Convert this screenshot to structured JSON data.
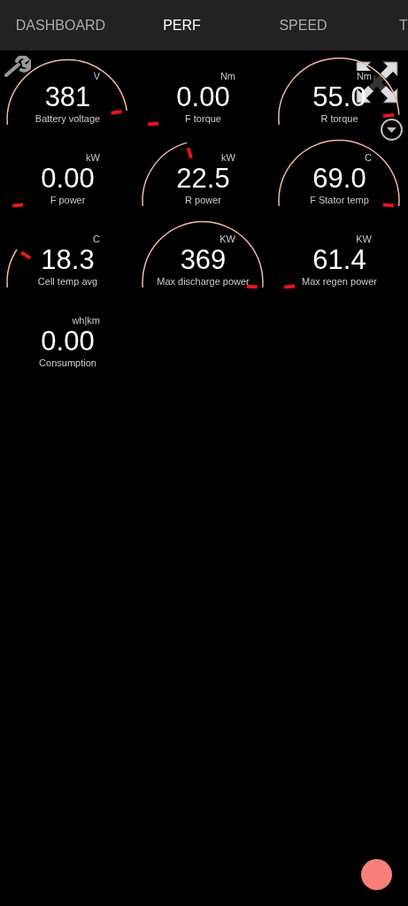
{
  "tabs": [
    {
      "label": "DASHBOARD",
      "selected": false
    },
    {
      "label": "PERF",
      "selected": true
    },
    {
      "label": "SPEED",
      "selected": false
    },
    {
      "label": "T",
      "selected": false
    }
  ],
  "gauges": [
    {
      "value": "381",
      "unit": "V",
      "label": "Battery voltage"
    },
    {
      "value": "0.00",
      "unit": "Nm",
      "label": "F torque"
    },
    {
      "value": "55.0",
      "unit": "Nm",
      "label": "R torque"
    },
    {
      "value": "0.00",
      "unit": "kW",
      "label": "F power"
    },
    {
      "value": "22.5",
      "unit": "kW",
      "label": "R power"
    },
    {
      "value": "69.0",
      "unit": "C",
      "label": "F Stator temp"
    },
    {
      "value": "18.3",
      "unit": "C",
      "label": "Cell temp avg"
    },
    {
      "value": "369",
      "unit": "KW",
      "label": "Max discharge power"
    },
    {
      "value": "61.4",
      "unit": "KW",
      "label": "Max regen power"
    },
    {
      "value": "0.00",
      "unit": "wh|km",
      "label": "Consumption"
    }
  ]
}
